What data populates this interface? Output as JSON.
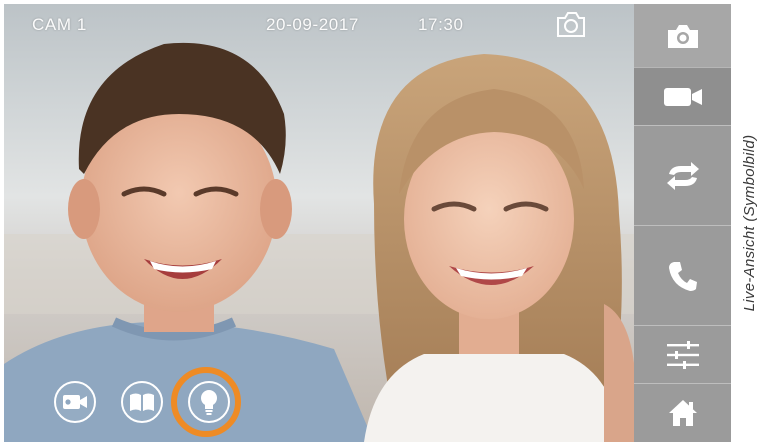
{
  "overlay": {
    "camera": "CAM 1",
    "date": "20-09-2017",
    "time": "17:30"
  },
  "bottom_buttons": [
    {
      "icon": "video-camera-icon",
      "selected": false
    },
    {
      "icon": "book-icon",
      "selected": false
    },
    {
      "icon": "light-bulb-icon",
      "selected": true
    }
  ],
  "sidebar": [
    {
      "icon": "camera-icon"
    },
    {
      "icon": "video-icon"
    },
    {
      "icon": "switch-arrows-icon"
    },
    {
      "icon": "phone-icon"
    },
    {
      "icon": "sliders-icon"
    },
    {
      "icon": "home-icon"
    }
  ],
  "caption": "Live-Ansicht (Symbolbild)",
  "colors": {
    "highlight": "#ee8b25",
    "sidebar": "#9b9b9b"
  }
}
